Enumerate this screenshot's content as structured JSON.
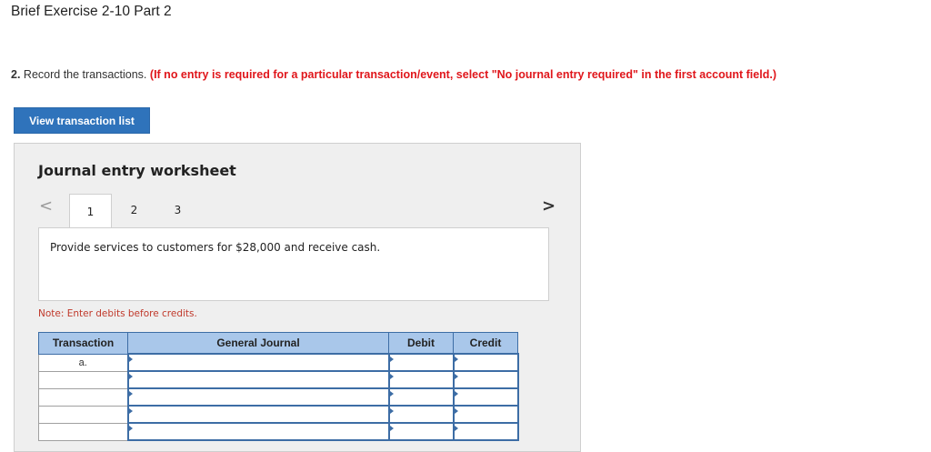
{
  "header": {
    "title": "Brief Exercise 2-10 Part 2"
  },
  "instruction": {
    "number": "2.",
    "text": "Record the transactions.",
    "warning": "(If no entry is required for a particular transaction/event, select \"No journal entry required\" in the first account field.)"
  },
  "buttons": {
    "view_transaction_list": "View transaction list"
  },
  "worksheet": {
    "title": "Journal entry worksheet",
    "nav": {
      "prev": "<",
      "next": ">"
    },
    "tabs": [
      {
        "label": "1",
        "active": true
      },
      {
        "label": "2",
        "active": false
      },
      {
        "label": "3",
        "active": false
      }
    ],
    "description": "Provide services to customers for $28,000 and receive cash.",
    "note": "Note: Enter debits before credits."
  },
  "journal": {
    "columns": [
      "Transaction",
      "General Journal",
      "Debit",
      "Credit"
    ],
    "rows": [
      {
        "transaction": "a.",
        "account": "",
        "debit": "",
        "credit": ""
      },
      {
        "transaction": "",
        "account": "",
        "debit": "",
        "credit": ""
      },
      {
        "transaction": "",
        "account": "",
        "debit": "",
        "credit": ""
      },
      {
        "transaction": "",
        "account": "",
        "debit": "",
        "credit": ""
      },
      {
        "transaction": "",
        "account": "",
        "debit": "",
        "credit": ""
      }
    ]
  },
  "colors": {
    "button_bg": "#2f73bb",
    "warning_text": "#e0161b",
    "table_header_bg": "#a9c7ea",
    "input_border": "#3d6da5"
  }
}
